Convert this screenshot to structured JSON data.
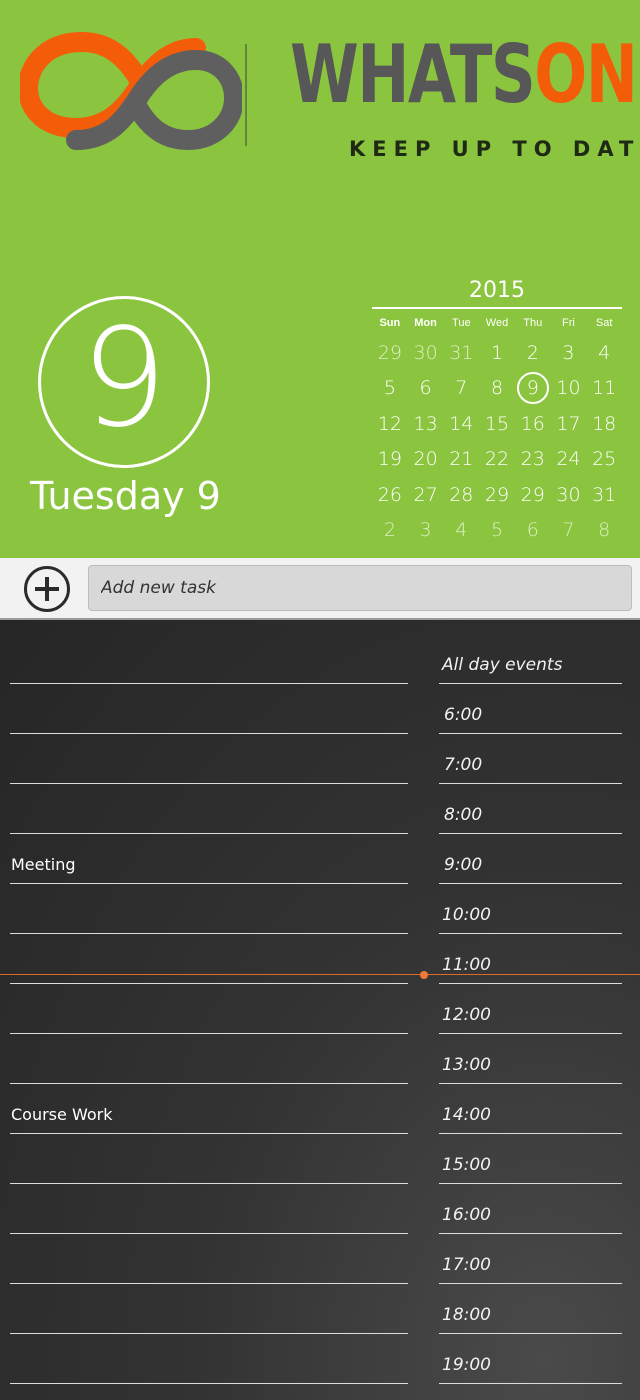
{
  "brand": {
    "name_part1": "WHATS",
    "name_part2": "ON",
    "tagline": "KEEP UP TO DATE",
    "accent": "#f35d0a",
    "logo_gray": "#575757"
  },
  "header_bg": "#8bc53f",
  "today": {
    "day_number": "9",
    "label": "Tuesday 9"
  },
  "calendar": {
    "year": "2015",
    "weekdays": [
      "Sun",
      "Mon",
      "Tue",
      "Wed",
      "Thu",
      "Fri",
      "Sat"
    ],
    "weeks": [
      [
        "29",
        "30",
        "31",
        "1",
        "2",
        "3",
        "4"
      ],
      [
        "5",
        "6",
        "7",
        "8",
        "9",
        "10",
        "11"
      ],
      [
        "12",
        "13",
        "14",
        "15",
        "16",
        "17",
        "18"
      ],
      [
        "19",
        "20",
        "21",
        "22",
        "23",
        "24",
        "25"
      ],
      [
        "26",
        "27",
        "28",
        "29",
        "29",
        "30",
        "31"
      ],
      [
        "2",
        "3",
        "4",
        "5",
        "6",
        "7",
        "8"
      ]
    ],
    "selected": "9"
  },
  "add_task": {
    "placeholder": "Add new task"
  },
  "schedule": {
    "rows": [
      {
        "time": "All day events",
        "task": ""
      },
      {
        "time": "6:00",
        "task": ""
      },
      {
        "time": "7:00",
        "task": ""
      },
      {
        "time": "8:00",
        "task": ""
      },
      {
        "time": "9:00",
        "task": "Meeting"
      },
      {
        "time": "10:00",
        "task": ""
      },
      {
        "time": "11:00",
        "task": ""
      },
      {
        "time": "12:00",
        "task": ""
      },
      {
        "time": "13:00",
        "task": ""
      },
      {
        "time": "14:00",
        "task": "Course Work"
      },
      {
        "time": "15:00",
        "task": ""
      },
      {
        "time": "16:00",
        "task": ""
      },
      {
        "time": "17:00",
        "task": ""
      },
      {
        "time": "18:00",
        "task": ""
      },
      {
        "time": "19:00",
        "task": ""
      }
    ],
    "now_color": "#e06a2c"
  }
}
